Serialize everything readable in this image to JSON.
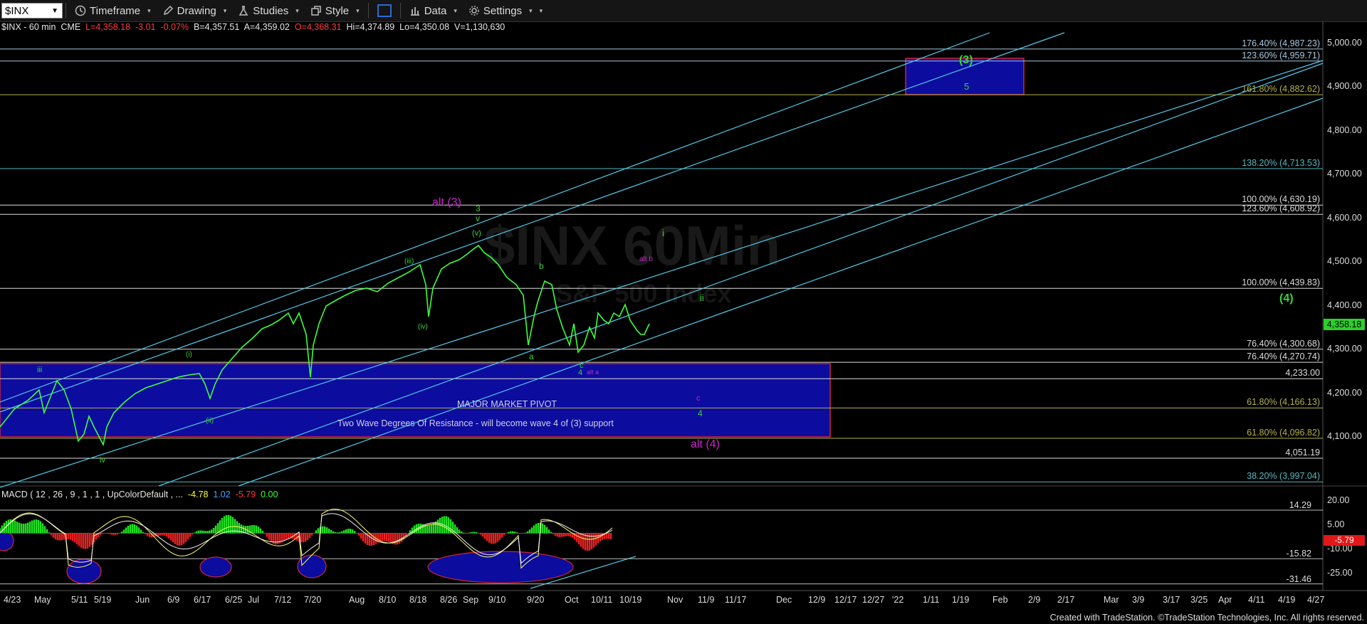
{
  "toolbar": {
    "symbol": "$INX",
    "timeframe_label": "Timeframe",
    "drawing_label": "Drawing",
    "studies_label": "Studies",
    "style_label": "Style",
    "data_label": "Data",
    "settings_label": "Settings"
  },
  "info": {
    "name": "$INX - 60 min",
    "exchange": "CME",
    "last": "L=4,358.18",
    "change": "-3.01",
    "change_pct": "-0.07%",
    "bid": "B=4,357.51",
    "ask": "A=4,359.02",
    "open": "O=4,368.31",
    "high": "Hi=4,374.89",
    "low": "Lo=4,350.08",
    "volume": "V=1,130,630"
  },
  "watermark": {
    "title": "$INX 60Min",
    "subtitle": "S&P 500 Index"
  },
  "price_axis": [
    "5,000.00",
    "4,900.00",
    "4,800.00",
    "4,700.00",
    "4,600.00",
    "4,500.00",
    "4,400.00",
    "4,300.00",
    "4,200.00",
    "4,100.00"
  ],
  "current_price": "4,358.18",
  "levels": [
    {
      "label": "176.40% (4,987.23)",
      "color": "#a9c7dd"
    },
    {
      "label": "123.60% (4,959.71)",
      "color": "#a9c7dd"
    },
    {
      "label": "161.80% (4,882.62)",
      "color": "#b5b24a"
    },
    {
      "label": "138.20% (4,713.53)",
      "color": "#59b8bf"
    },
    {
      "label": "100.00% (4,630.19)",
      "color": "#dddddd"
    },
    {
      "label": "123.60% (4,608.92)",
      "color": "#dddddd"
    },
    {
      "label": "100.00% (4,439.83)",
      "color": "#dddddd"
    },
    {
      "label": "76.40% (4,300.68)",
      "color": "#dddddd"
    },
    {
      "label": "76.40% (4,270.74)",
      "color": "#dddddd"
    },
    {
      "label": "4,233.00",
      "color": "#dddddd"
    },
    {
      "label": "61.80% (4,166.13)",
      "color": "#b5b24a"
    },
    {
      "label": "61.80% (4,096.82)",
      "color": "#b5b24a"
    },
    {
      "label": "4,051.19",
      "color": "#dddddd"
    },
    {
      "label": "38.20% (3,997.04)",
      "color": "#59b8bf"
    }
  ],
  "annotations": {
    "wave3_green": "(3)",
    "five": "5",
    "wave4_green": "(4)",
    "alt3": "alt (3)",
    "three": "3",
    "v": "v",
    "v_paren": "(v)",
    "i": "i",
    "alt_b": "alt b",
    "iii_paren": "(iii)",
    "b": "b",
    "ii": "ii",
    "iv_paren": "(iv)",
    "i_paren": "(i)",
    "iii": "iii",
    "a": "a",
    "c": "c",
    "four": "4",
    "alt_a": "alt a",
    "ii_paren": "(ii)",
    "iv": "iv",
    "c_purple": "c",
    "four_green": "4",
    "alt4": "alt (4)",
    "pivot": "MAJOR MARKET PIVOT",
    "pivot_sub": "Two Wave Degrees Of Resistance - will become wave 4 of (3) support"
  },
  "macd": {
    "label": "MACD ( 12 , 26 , 9 , 1 , 1 , UpColorDefault , ...",
    "v1": "-4.78",
    "v2": "1.02",
    "v3": "-5.79",
    "v4": "0.00",
    "axis": [
      "20.00",
      "5.00",
      "-10.00",
      "-25.00"
    ],
    "current": "-5.79",
    "levels": [
      "14.29",
      "-15.82",
      "-31.46"
    ]
  },
  "x_axis": [
    "4/23",
    "May",
    "5/11",
    "5/19",
    "Jun",
    "6/9",
    "6/17",
    "6/25",
    "Jul",
    "7/12",
    "7/20",
    "Aug",
    "8/10",
    "8/18",
    "8/26",
    "Sep",
    "9/10",
    "9/20",
    "Oct",
    "10/11",
    "10/19",
    "Nov",
    "11/9",
    "11/17",
    "Dec",
    "12/9",
    "12/17",
    "12/27",
    "'22",
    "1/11",
    "1/19",
    "Feb",
    "2/9",
    "2/17",
    "Mar",
    "3/9",
    "3/17",
    "3/25",
    "Apr",
    "4/11",
    "4/19",
    "4/27"
  ],
  "footer": "Created with TradeStation. ©TradeStation Technologies, Inc. All rights reserved.",
  "colors": {
    "background": "#000000",
    "price": "#3cff3c",
    "channel": "#52c8e8",
    "box": "#0c0c9e",
    "box_border": "#d0253a",
    "purple": "#c826c8",
    "green_label": "#39d339"
  }
}
